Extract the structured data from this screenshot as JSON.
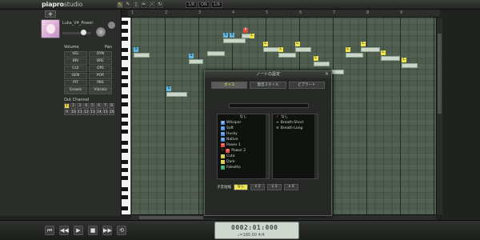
{
  "app": {
    "logo_main": "piapro",
    "logo_sub": "studio"
  },
  "toolbar": {
    "tools": [
      "↖",
      "✎",
      "▯",
      "✏",
      "⤫",
      "↻"
    ],
    "quantize": "1/8",
    "snap": "ON",
    "mode": "1/8"
  },
  "ruler": {
    "measures": [
      "1",
      "2",
      "3",
      "4",
      "5",
      "6",
      "7",
      "8",
      "9"
    ]
  },
  "track": {
    "add_label": "+",
    "name": "Luka_V4_Power"
  },
  "params": {
    "header_left": "Volume",
    "header_right": "Pan",
    "rows": [
      [
        "VEL",
        "DYN"
      ],
      [
        "BRI",
        "BRE"
      ],
      [
        "CLE",
        "OPE"
      ],
      [
        "GEN",
        "POR"
      ],
      [
        "PIT",
        "PBS"
      ]
    ],
    "bottom": [
      "Growls",
      "Vibrato"
    ]
  },
  "midi": {
    "label": "Out Channel",
    "channels": [
      "1",
      "2",
      "3",
      "4",
      "5",
      "6",
      "7",
      "8",
      "9",
      "10",
      "11",
      "12",
      "13",
      "14",
      "15",
      "16"
    ],
    "selected": "1"
  },
  "dialog": {
    "title": "ノートの設定",
    "tabs": [
      "ボイス",
      "発音スタイル",
      "ビブラート"
    ],
    "left_header": "なし",
    "left_items": [
      {
        "code": "W",
        "label": "Whisper",
        "color": "#4c8fe0"
      },
      {
        "code": "S",
        "label": "Soft",
        "color": "#4c8fe0"
      },
      {
        "code": "H",
        "label": "Husky",
        "color": "#4c8fe0"
      },
      {
        "code": "N",
        "label": "Native",
        "color": "#4c8fe0"
      },
      {
        "code": "P",
        "label": "Power 1",
        "color": "#e04c3a"
      },
      {
        "code": "P",
        "label": "Power 2",
        "color": "#e04c3a"
      },
      {
        "code": "C",
        "label": "Cute",
        "color": "#d7c53a"
      },
      {
        "code": "D",
        "label": "Dark",
        "color": "#d7c53a"
      },
      {
        "code": "F",
        "label": "Falsetto",
        "color": "#3aa86a"
      }
    ],
    "right_header": "なし",
    "right_items": [
      "Breath-Short",
      "Breath-Long"
    ],
    "subdivision_label": "子音短縮",
    "subdivision_options": [
      "なし",
      "x 2",
      "x 3",
      "x 4"
    ],
    "subdivision_selected": "なし"
  },
  "counter": {
    "main": "0002:01:000",
    "sub": "♩=180.00  4/4"
  },
  "transport": {
    "buttons": [
      "⏮",
      "◀◀",
      "▶",
      "■",
      "▶▶",
      "⟲"
    ]
  }
}
